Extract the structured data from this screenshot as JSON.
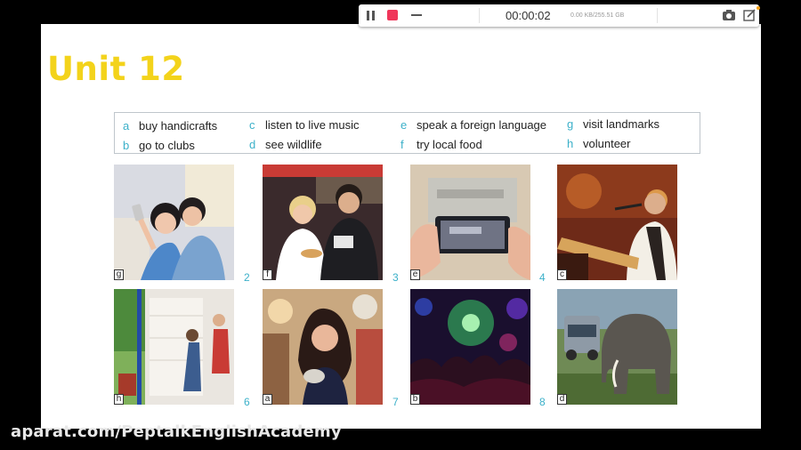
{
  "recorder": {
    "timer": "00:00:02",
    "storage": "0.00 KB/255.51 GB",
    "icons": [
      "pause-icon",
      "stop-icon",
      "minimize-icon",
      "camera-icon",
      "edit-icon"
    ]
  },
  "slide": {
    "title": "Unit 12",
    "options": [
      {
        "letter": "a",
        "text": "buy handicrafts"
      },
      {
        "letter": "b",
        "text": "go to clubs"
      },
      {
        "letter": "c",
        "text": "listen to live music"
      },
      {
        "letter": "d",
        "text": "see wildlife"
      },
      {
        "letter": "e",
        "text": "speak a foreign language"
      },
      {
        "letter": "f",
        "text": "try local food"
      },
      {
        "letter": "g",
        "text": "visit landmarks"
      },
      {
        "letter": "h",
        "text": "volunteer"
      }
    ],
    "photos": [
      {
        "tag": "g",
        "number": "",
        "desc": "selfie"
      },
      {
        "tag": "f",
        "number": "2",
        "desc": "street-food"
      },
      {
        "tag": "e",
        "number": "3",
        "desc": "phone-photo"
      },
      {
        "tag": "c",
        "number": "4",
        "desc": "guitarist"
      },
      {
        "tag": "h",
        "number": "",
        "desc": "painting-house"
      },
      {
        "tag": "a",
        "number": "6",
        "desc": "market-shopper"
      },
      {
        "tag": "b",
        "number": "7",
        "desc": "nightclub"
      },
      {
        "tag": "d",
        "number": "8",
        "desc": "elephant"
      }
    ]
  },
  "watermark": "aparat.com/PeptalkEnglishAcademy",
  "colors": {
    "title": "#f3d31b",
    "accent": "#3bb0c9",
    "stop": "#f0365a"
  }
}
